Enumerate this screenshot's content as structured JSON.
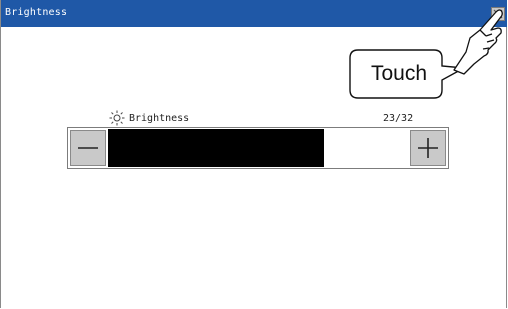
{
  "window": {
    "title": "Brightness"
  },
  "brightness": {
    "label": "Brightness",
    "level_text": "23/32",
    "level": 23,
    "max": 32,
    "icon": "sun-icon"
  },
  "buttons": {
    "decrease_icon": "minus-icon",
    "increase_icon": "plus-icon",
    "close_icon": "close-icon"
  },
  "callout": {
    "text": "Touch",
    "icon": "pointing-hand-icon"
  },
  "colors": {
    "titlebar": "#1f58a7",
    "fill": "#000000",
    "button": "#c9c9c9"
  }
}
